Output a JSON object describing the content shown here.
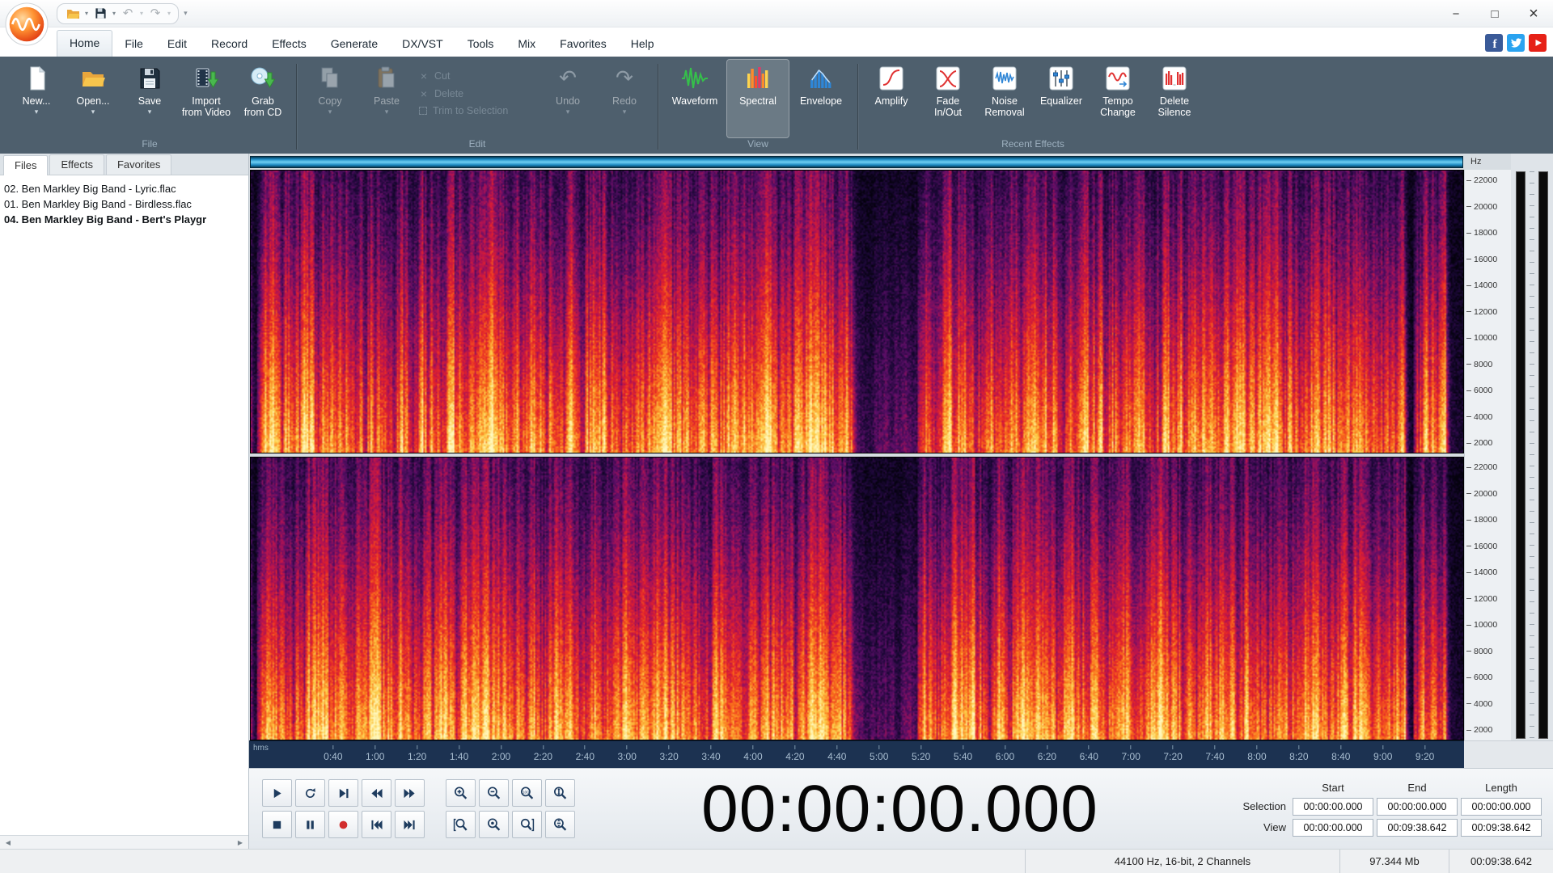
{
  "titlebar": {
    "minimize": "−",
    "maximize": "□",
    "close": "×"
  },
  "menubar": {
    "tabs": [
      {
        "name": "tab-home",
        "label": "Home",
        "active": true
      },
      {
        "name": "tab-file",
        "label": "File"
      },
      {
        "name": "tab-edit",
        "label": "Edit"
      },
      {
        "name": "tab-record",
        "label": "Record"
      },
      {
        "name": "tab-effects",
        "label": "Effects"
      },
      {
        "name": "tab-generate",
        "label": "Generate"
      },
      {
        "name": "tab-dx-vst",
        "label": "DX/VST"
      },
      {
        "name": "tab-tools",
        "label": "Tools"
      },
      {
        "name": "tab-mix",
        "label": "Mix"
      },
      {
        "name": "tab-favorites",
        "label": "Favorites"
      },
      {
        "name": "tab-help",
        "label": "Help"
      }
    ]
  },
  "ribbon": {
    "file": {
      "group_label": "File",
      "new": "New...",
      "open": "Open...",
      "save": "Save",
      "import": "Import\nfrom Video",
      "grab": "Grab\nfrom CD"
    },
    "edit": {
      "group_label": "Edit",
      "copy": "Copy",
      "paste": "Paste",
      "cut": "Cut",
      "del": "Delete",
      "trim": "Trim to Selection",
      "undo": "Undo",
      "redo": "Redo"
    },
    "view": {
      "group_label": "View",
      "waveform": "Waveform",
      "spectral": "Spectral",
      "envelope": "Envelope"
    },
    "recent": {
      "group_label": "Recent Effects",
      "amplify": "Amplify",
      "fade": "Fade\nIn/Out",
      "noise": "Noise\nRemoval",
      "equalizer": "Equalizer",
      "tempo": "Tempo\nChange",
      "silence": "Delete\nSilence"
    }
  },
  "sidebar": {
    "tabs": [
      {
        "name": "tab-files",
        "label": "Files",
        "active": true
      },
      {
        "name": "tab-effects-panel",
        "label": "Effects"
      },
      {
        "name": "tab-favorites-panel",
        "label": "Favorites"
      }
    ],
    "files": [
      {
        "label": "02. Ben Markley Big Band - Lyric.flac"
      },
      {
        "label": "01. Ben Markley Big Band - Birdless.flac"
      },
      {
        "label": "04. Ben Markley Big Band - Bert's Playgr",
        "bold": true
      }
    ]
  },
  "spectrogram": {
    "hz_label": "Hz",
    "hms_label": "hms",
    "freq_labels": [
      "22000",
      "20000",
      "18000",
      "16000",
      "14000",
      "12000",
      "10000",
      "8000",
      "6000",
      "4000",
      "2000"
    ],
    "duration_sec": 578.642,
    "time_ticks": [
      {
        "t": 40,
        "label": "0:40"
      },
      {
        "t": 60,
        "label": "1:00"
      },
      {
        "t": 80,
        "label": "1:20"
      },
      {
        "t": 100,
        "label": "1:40"
      },
      {
        "t": 120,
        "label": "2:00"
      },
      {
        "t": 140,
        "label": "2:20"
      },
      {
        "t": 160,
        "label": "2:40"
      },
      {
        "t": 180,
        "label": "3:00"
      },
      {
        "t": 200,
        "label": "3:20"
      },
      {
        "t": 220,
        "label": "3:40"
      },
      {
        "t": 240,
        "label": "4:00"
      },
      {
        "t": 260,
        "label": "4:20"
      },
      {
        "t": 280,
        "label": "4:40"
      },
      {
        "t": 300,
        "label": "5:00"
      },
      {
        "t": 320,
        "label": "5:20"
      },
      {
        "t": 340,
        "label": "5:40"
      },
      {
        "t": 360,
        "label": "6:00"
      },
      {
        "t": 380,
        "label": "6:20"
      },
      {
        "t": 400,
        "label": "6:40"
      },
      {
        "t": 420,
        "label": "7:00"
      },
      {
        "t": 440,
        "label": "7:20"
      },
      {
        "t": 460,
        "label": "7:40"
      },
      {
        "t": 480,
        "label": "8:00"
      },
      {
        "t": 500,
        "label": "8:20"
      },
      {
        "t": 520,
        "label": "8:40"
      },
      {
        "t": 540,
        "label": "9:00"
      },
      {
        "t": 560,
        "label": "9:20"
      }
    ]
  },
  "transport": {
    "row1": [
      {
        "name": "play-button",
        "icon": "play"
      },
      {
        "name": "loop-button",
        "icon": "loop"
      },
      {
        "name": "play-to-end-button",
        "icon": "playend"
      },
      {
        "name": "rewind-button",
        "icon": "rew"
      },
      {
        "name": "fast-forward-button",
        "icon": "ffw"
      }
    ],
    "row2": [
      {
        "name": "stop-button",
        "icon": "stop"
      },
      {
        "name": "pause-button",
        "icon": "pause"
      },
      {
        "name": "record-button",
        "icon": "record",
        "cls": "rec"
      },
      {
        "name": "go-to-start-button",
        "icon": "tostart"
      },
      {
        "name": "go-to-end-button",
        "icon": "toend"
      }
    ]
  },
  "zoom": {
    "row1": [
      {
        "name": "zoom-in-button",
        "icon": "zin"
      },
      {
        "name": "zoom-out-button",
        "icon": "zout"
      },
      {
        "name": "zoom-100-button",
        "icon": "z100"
      },
      {
        "name": "vertical-zoom-in-button",
        "icon": "zvin"
      }
    ],
    "row2": [
      {
        "name": "zoom-selection-start-button",
        "icon": "zselin"
      },
      {
        "name": "zoom-full-button",
        "icon": "zdot"
      },
      {
        "name": "zoom-selection-end-button",
        "icon": "zselout"
      },
      {
        "name": "vertical-zoom-out-button",
        "icon": "zvout"
      }
    ]
  },
  "time_display": "00:00:00.000",
  "selection_panel": {
    "headers": [
      "Start",
      "End",
      "Length"
    ],
    "rows": [
      {
        "label": "Selection",
        "start": "00:00:00.000",
        "end": "00:00:00.000",
        "length": "00:00:00.000"
      },
      {
        "label": "View",
        "start": "00:00:00.000",
        "end": "00:09:38.642",
        "length": "00:09:38.642"
      }
    ]
  },
  "statusbar": {
    "format": "44100 Hz, 16-bit, 2 Channels",
    "size": "97.344 Mb",
    "length": "00:09:38.642"
  },
  "colors": {
    "ribbon_bg": "#4e5f6d",
    "timeline_bg": "#1c3251",
    "overview_blue": "#2aa3dd",
    "record_red": "#d22d2d",
    "facebook_blue": "#3a5a98",
    "twitter_blue": "#2aa3f0",
    "youtube_red": "#e62117"
  }
}
